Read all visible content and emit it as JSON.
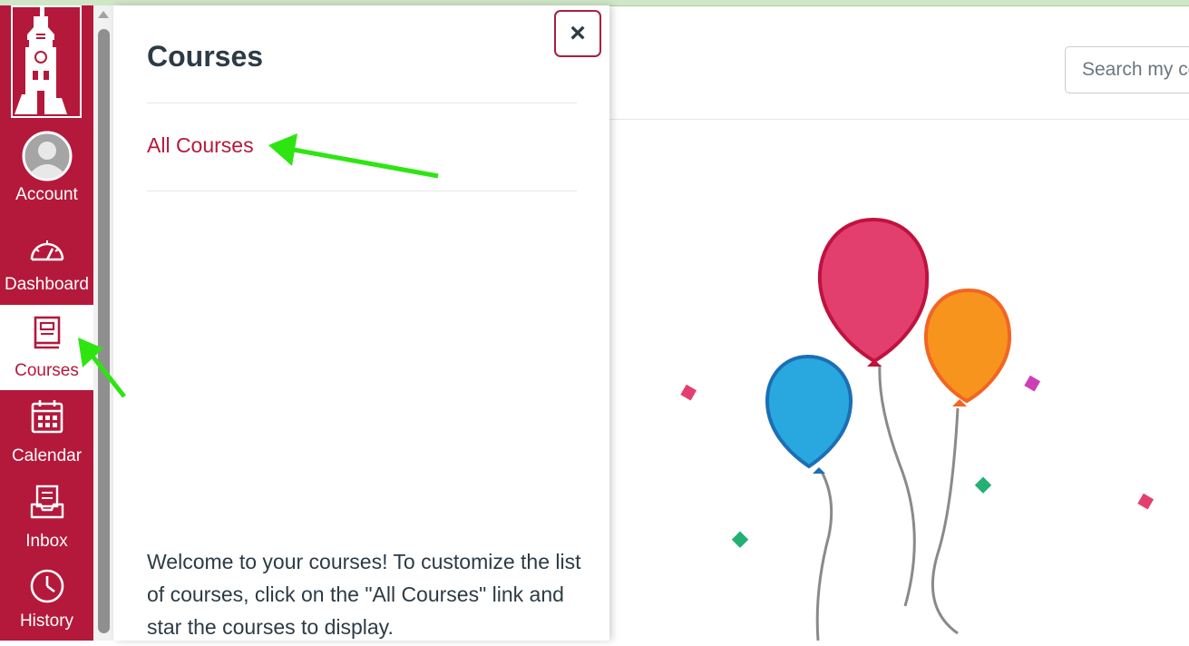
{
  "nav": {
    "items": [
      {
        "id": "account",
        "label": "Account",
        "icon": "avatar-icon",
        "active": false
      },
      {
        "id": "dashboard",
        "label": "Dashboard",
        "icon": "gauge-icon",
        "active": false
      },
      {
        "id": "courses",
        "label": "Courses",
        "icon": "book-icon",
        "active": true
      },
      {
        "id": "calendar",
        "label": "Calendar",
        "icon": "calendar-icon",
        "active": false
      },
      {
        "id": "inbox",
        "label": "Inbox",
        "icon": "inbox-icon",
        "active": false
      },
      {
        "id": "history",
        "label": "History",
        "icon": "clock-icon",
        "active": false
      }
    ]
  },
  "tray": {
    "title": "Courses",
    "close_label": "×",
    "links": [
      {
        "label": "All Courses"
      }
    ],
    "footer": "Welcome to your courses! To customize the list of courses, click on the \"All Courses\" link and star the courses to display."
  },
  "search": {
    "placeholder": "Search my courses..."
  },
  "colors": {
    "brand": "#b4193b",
    "text": "#2d3b45",
    "annotation_arrow": "#2ee512",
    "balloon_pink": "#e33f6e",
    "balloon_orange": "#f7941d",
    "balloon_blue": "#29a8e0"
  }
}
